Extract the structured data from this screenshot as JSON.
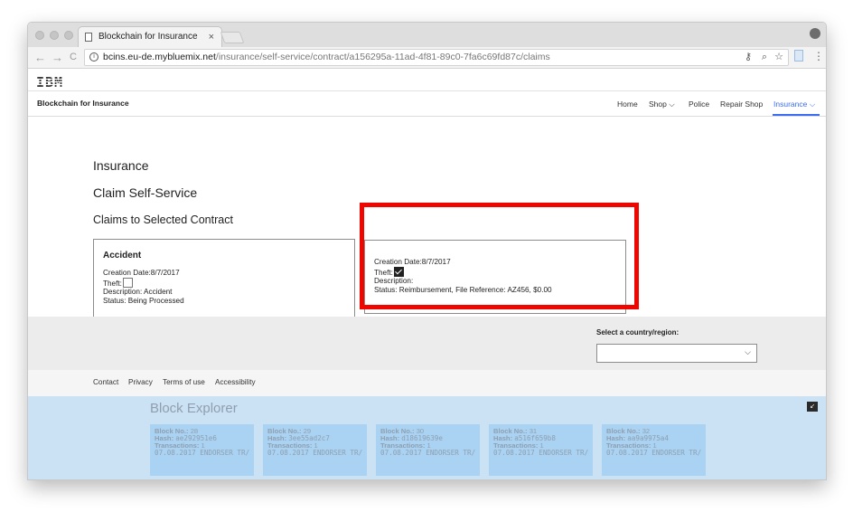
{
  "browser": {
    "tab_title": "Blockchain for Insurance",
    "tab_close": "×",
    "url_host": "bcins.eu-de.mybluemix.net",
    "url_path": "/insurance/self-service/contract/a156295a-11ad-4f81-89c0-7fa6c69fd87c/claims",
    "nav": {
      "back": "←",
      "forward": "→",
      "reload": "C"
    },
    "icons": [
      "key-icon",
      "zoom-icon",
      "star-icon",
      "extension-icon",
      "menu-icon"
    ]
  },
  "header": {
    "logo": "IBM",
    "site_title": "Blockchain for Insurance",
    "nav": {
      "home": "Home",
      "shop": "Shop",
      "police": "Police",
      "repair_shop": "Repair Shop",
      "insurance": "Insurance"
    },
    "accent": "#3c6df0"
  },
  "main": {
    "title": "Insurance",
    "subtitle": "Claim Self-Service",
    "section": "Claims to Selected Contract",
    "claims": [
      {
        "title": "Accident",
        "creation": "Creation Date:8/7/2017",
        "theft_label": "Theft:",
        "theft_checked": false,
        "description": "Description: Accident",
        "status": "Status: Being Processed"
      },
      {
        "title": "",
        "creation": "Creation Date:8/7/2017",
        "theft_label": "Theft:",
        "theft_checked": true,
        "description": "Description:",
        "status": "Status: Reimbursement, File Reference: AZ456, $0.00"
      }
    ],
    "highlight_color": "#f00600"
  },
  "footer": {
    "country_label": "Select a country/region:",
    "country_value": "",
    "links": {
      "contact": "Contact",
      "privacy": "Privacy",
      "terms": "Terms of use",
      "accessibility": "Accessibility"
    }
  },
  "explorer": {
    "title": "Block Explorer",
    "blocks": [
      {
        "no_label": "Block No.:",
        "no": "28",
        "hash_label": "Hash:",
        "hash": "ae292951e6",
        "tx_label": "Transactions:",
        "tx": "1",
        "detail": "07.08.2017 ENDORSER TR/"
      },
      {
        "no_label": "Block No.:",
        "no": "29",
        "hash_label": "Hash:",
        "hash": "3ee55ad2c7",
        "tx_label": "Transactions:",
        "tx": "1",
        "detail": "07.08.2017 ENDORSER TR/"
      },
      {
        "no_label": "Block No.:",
        "no": "30",
        "hash_label": "Hash:",
        "hash": "d18619639e",
        "tx_label": "Transactions:",
        "tx": "1",
        "detail": "07.08.2017 ENDORSER TR/"
      },
      {
        "no_label": "Block No.:",
        "no": "31",
        "hash_label": "Hash:",
        "hash": "a516f659b8",
        "tx_label": "Transactions:",
        "tx": "1",
        "detail": "07.08.2017 ENDORSER TR/"
      },
      {
        "no_label": "Block No.:",
        "no": "32",
        "hash_label": "Hash:",
        "hash": "aa9a9975a4",
        "tx_label": "Transactions:",
        "tx": "1",
        "detail": "07.08.2017 ENDORSER TR/"
      }
    ]
  }
}
